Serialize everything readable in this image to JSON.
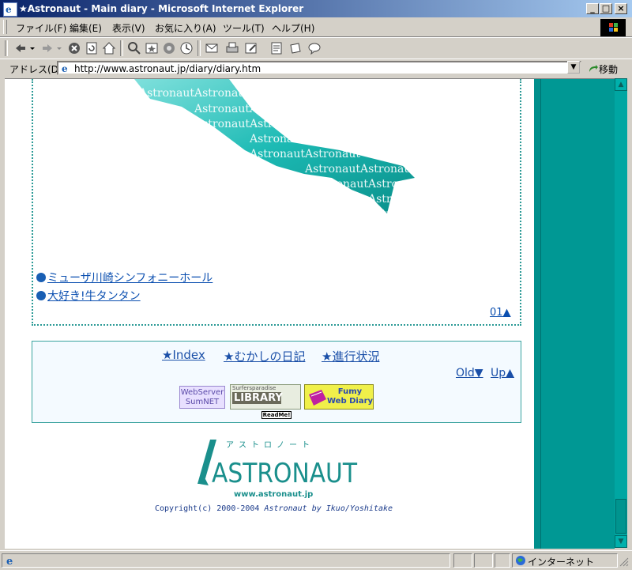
{
  "window": {
    "title": "★Astronaut - Main diary - Microsoft Internet Explorer"
  },
  "menu": [
    "ファイル(F)",
    "編集(E)",
    "表示(V)",
    "お気に入り(A)",
    "ツール(T)",
    "ヘルプ(H)"
  ],
  "address": {
    "label": "アドレス(D)",
    "url": "http://www.astronaut.jp/diary/diary.htm",
    "go_label": "移動"
  },
  "content": {
    "watermark_text": "Astronaut",
    "links": [
      {
        "label": "ミューザ川崎シンフォニーホール"
      },
      {
        "label": "大好き!牛タンタン"
      }
    ],
    "page_marker": "01▲",
    "nav": {
      "index": "★Index",
      "old_diary": "★むかしの日記",
      "progress": "★進行状況",
      "old": "Old▼",
      "up": "Up▲"
    },
    "badges": {
      "webserver": "WebServer\nSumNET",
      "library_top": "Surfersparadise",
      "library": "LIBRARY",
      "fumy": "Fumy\nWeb Diary",
      "readme": "ReadMe!"
    },
    "footer": {
      "logo_kana": "アストロノート",
      "logo_text": "ASTRONAUT",
      "site_url": "www.astronaut.jp",
      "copyright": "Copyright(c) 2000-2004",
      "copyright_author": "Astronaut by Ikuo/Yoshitake"
    }
  },
  "status": {
    "zone": "インターネット"
  },
  "colors": {
    "teal": "#009894",
    "link": "#1a4fa8",
    "title_start": "#0a246a"
  }
}
